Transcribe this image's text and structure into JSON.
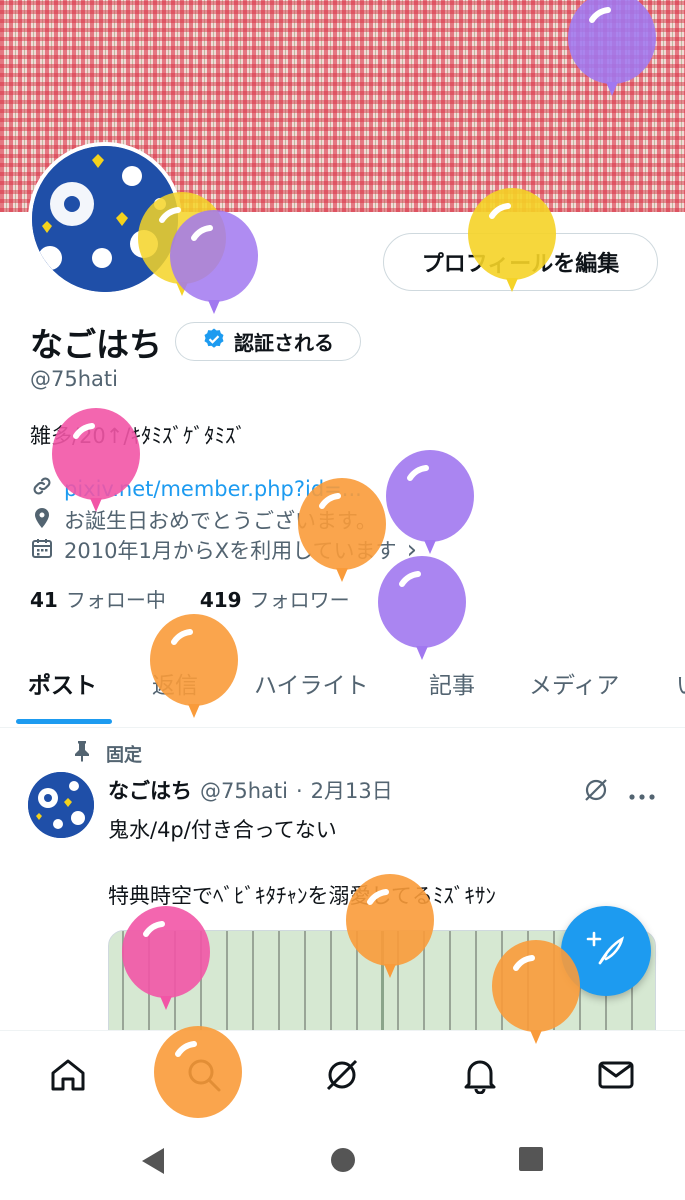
{
  "profile": {
    "display_name": "なごはち",
    "verify_label": "認証される",
    "edit_profile_label": "プロフィールを編集",
    "handle": "@75hati",
    "bio": "雑多/20↑/ｷﾀﾐｽﾞｹﾞﾀﾐｽﾞ",
    "link": "pixiv.net/member.php?id=...",
    "location": "お誕生日おめでとうございます。",
    "joined": "2010年1月からXを利用しています",
    "joined_chevron": "›",
    "following_count": "41",
    "following_label": "フォロー中",
    "followers_count": "419",
    "followers_label": "フォロワー"
  },
  "tabs": [
    "ポスト",
    "返信",
    "ハイライト",
    "記事",
    "メディア",
    "い"
  ],
  "tweet": {
    "pinned_label": "固定",
    "name": "なごはち",
    "handle": "@75hati",
    "separator": "·",
    "date": "2月13日",
    "line1": "鬼水/4p/付き合ってない",
    "line2": "特典時空でﾍﾞﾋﾞｷﾀﾁｬﾝを溺愛してるﾐｽﾞｷｻﾝ"
  },
  "colors": {
    "accent": "#1d9bf0",
    "text_primary": "#0f1419",
    "text_secondary": "#536471",
    "balloon_yellow": "#f5d327",
    "balloon_purple": "#a178f0",
    "balloon_orange": "#f99b3a",
    "balloon_pink": "#f255a6"
  },
  "icons": {
    "nav": [
      "home-icon",
      "search-icon",
      "grok-icon",
      "bell-icon",
      "mail-icon"
    ],
    "system": [
      "back-icon",
      "home-circle-icon",
      "recents-icon"
    ]
  }
}
